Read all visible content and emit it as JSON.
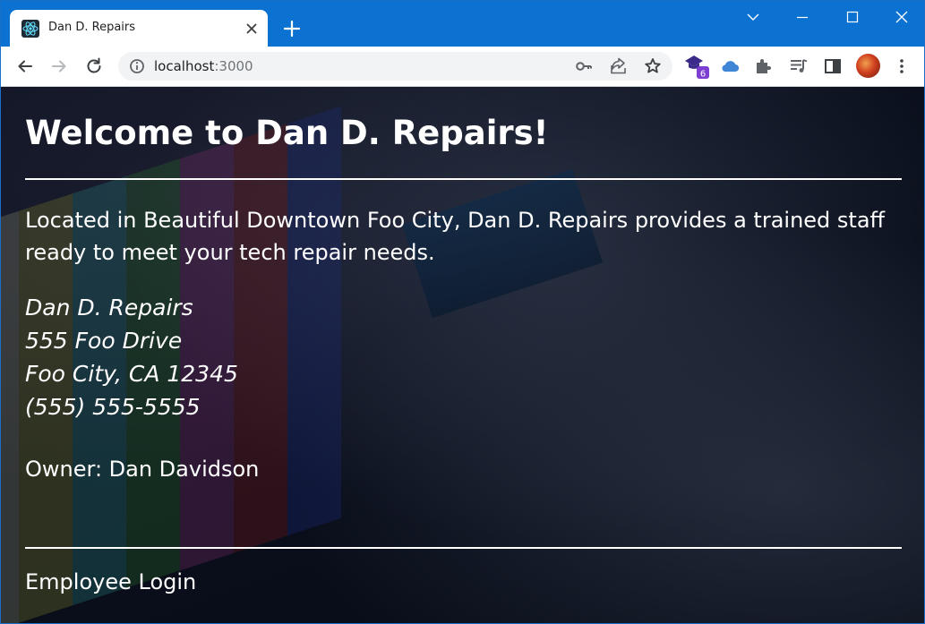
{
  "browser": {
    "tab": {
      "title": "Dan D. Repairs",
      "favicon": "react-logo-icon"
    },
    "address_bar": {
      "host": "localhost",
      "port": ":3000"
    },
    "extension_badge": "6",
    "colors": {
      "frame": "#0b72d1",
      "toolbar": "#ffffff",
      "omnibox": "#f1f3f4"
    }
  },
  "page": {
    "title": "Welcome to Dan D. Repairs!",
    "intro": "Located in Beautiful Downtown Foo City, Dan D. Repairs provides a trained staff ready to meet your tech repair needs.",
    "address": {
      "name": "Dan D. Repairs",
      "street": "555 Foo Drive",
      "city_line": "Foo City, CA 12345",
      "phone": "(555) 555-5555"
    },
    "owner": "Owner: Dan Davidson",
    "footer_link": "Employee Login",
    "colors": {
      "text": "#ffffff",
      "background": "#0a0f1c"
    }
  }
}
